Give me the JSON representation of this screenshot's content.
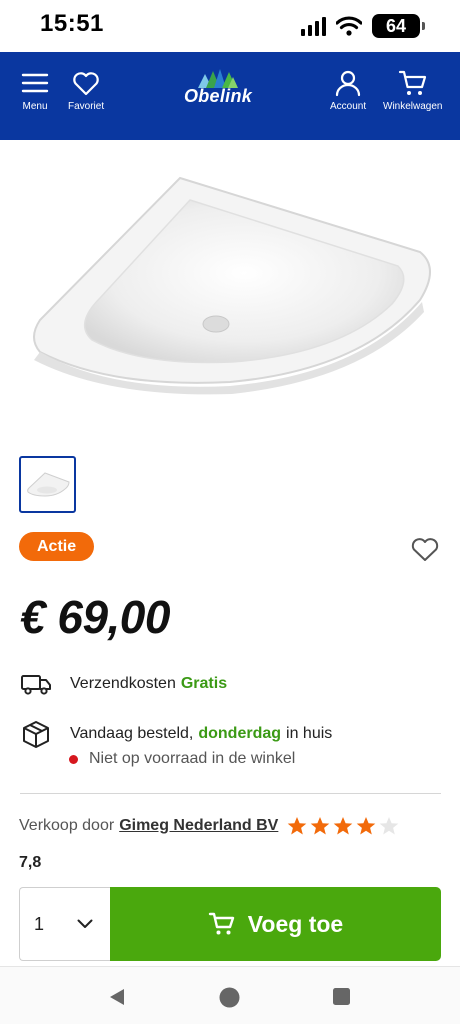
{
  "status_bar": {
    "time": "15:51",
    "battery": "64"
  },
  "header": {
    "menu_label": "Menu",
    "favorites_label": "Favoriet",
    "logo_text": "Obelink",
    "account_label": "Account",
    "cart_label": "Winkelwagen",
    "brand_color": "#0a37a0"
  },
  "product": {
    "badge": "Actie",
    "price": "€ 69,00",
    "shipping_label": "Verzendkosten",
    "shipping_value": "Gratis",
    "delivery_prefix": "Vandaag besteld,",
    "delivery_day": "donderdag",
    "delivery_suffix": "in huis",
    "stock_text": "Niet op voorraad in de winkel",
    "seller_prefix": "Verkoop door",
    "seller_name": "Gimeg Nederland BV",
    "rating": "7,8",
    "stars_filled": 4,
    "stars_total": 5
  },
  "purchase": {
    "quantity": "1",
    "add_button": "Voeg toe",
    "button_color": "#4aa80d"
  },
  "icons": [
    "menu-icon",
    "heart-icon",
    "account-icon",
    "cart-icon",
    "truck-icon",
    "box-icon",
    "chevron-down-icon",
    "star-icon"
  ]
}
